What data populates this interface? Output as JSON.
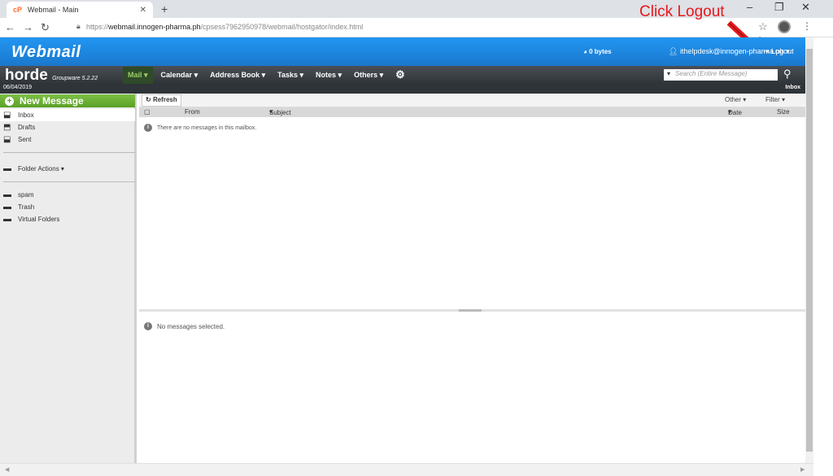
{
  "browser": {
    "tab_title": "Webmail - Main",
    "favicon": "cP",
    "url_prefix": "https://",
    "url_host": "webmail.innogen-pharma.ph",
    "url_path": "/cpsess7962950978/webmail/hostgator/index.html"
  },
  "annotation": {
    "callout": "Click Logout",
    "color": "#e8181c"
  },
  "header": {
    "logo": "Webmail",
    "disk_usage": "0 bytes",
    "user": "ithelpdesk@innogen-pharma.ph",
    "logout": "Logout"
  },
  "horde": {
    "logo": "horde",
    "version": "Groupware 5.2.22",
    "menu": [
      "Mail",
      "Calendar",
      "Address Book",
      "Tasks",
      "Notes",
      "Others"
    ],
    "search_placeholder": "Search (Entire Message)",
    "date": "06/04/2019",
    "mailbox_title": "Inbox"
  },
  "sidebar": {
    "new_message": "New Message",
    "folders": [
      "Inbox",
      "Drafts",
      "Sent"
    ],
    "folder_actions": "Folder Actions",
    "extra_folders": [
      "spam",
      "Trash",
      "Virtual Folders"
    ]
  },
  "list": {
    "refresh": "Refresh",
    "other": "Other",
    "filter": "Filter",
    "columns": {
      "from": "From",
      "subject": "Subject",
      "date": "Date",
      "size": "Size"
    },
    "empty": "There are no messages in this mailbox."
  },
  "preview": {
    "empty": "No messages selected."
  },
  "colors": {
    "accent": "#1a78cc",
    "brand_green": "#5aa025",
    "dark_bar": "#2f3438"
  }
}
